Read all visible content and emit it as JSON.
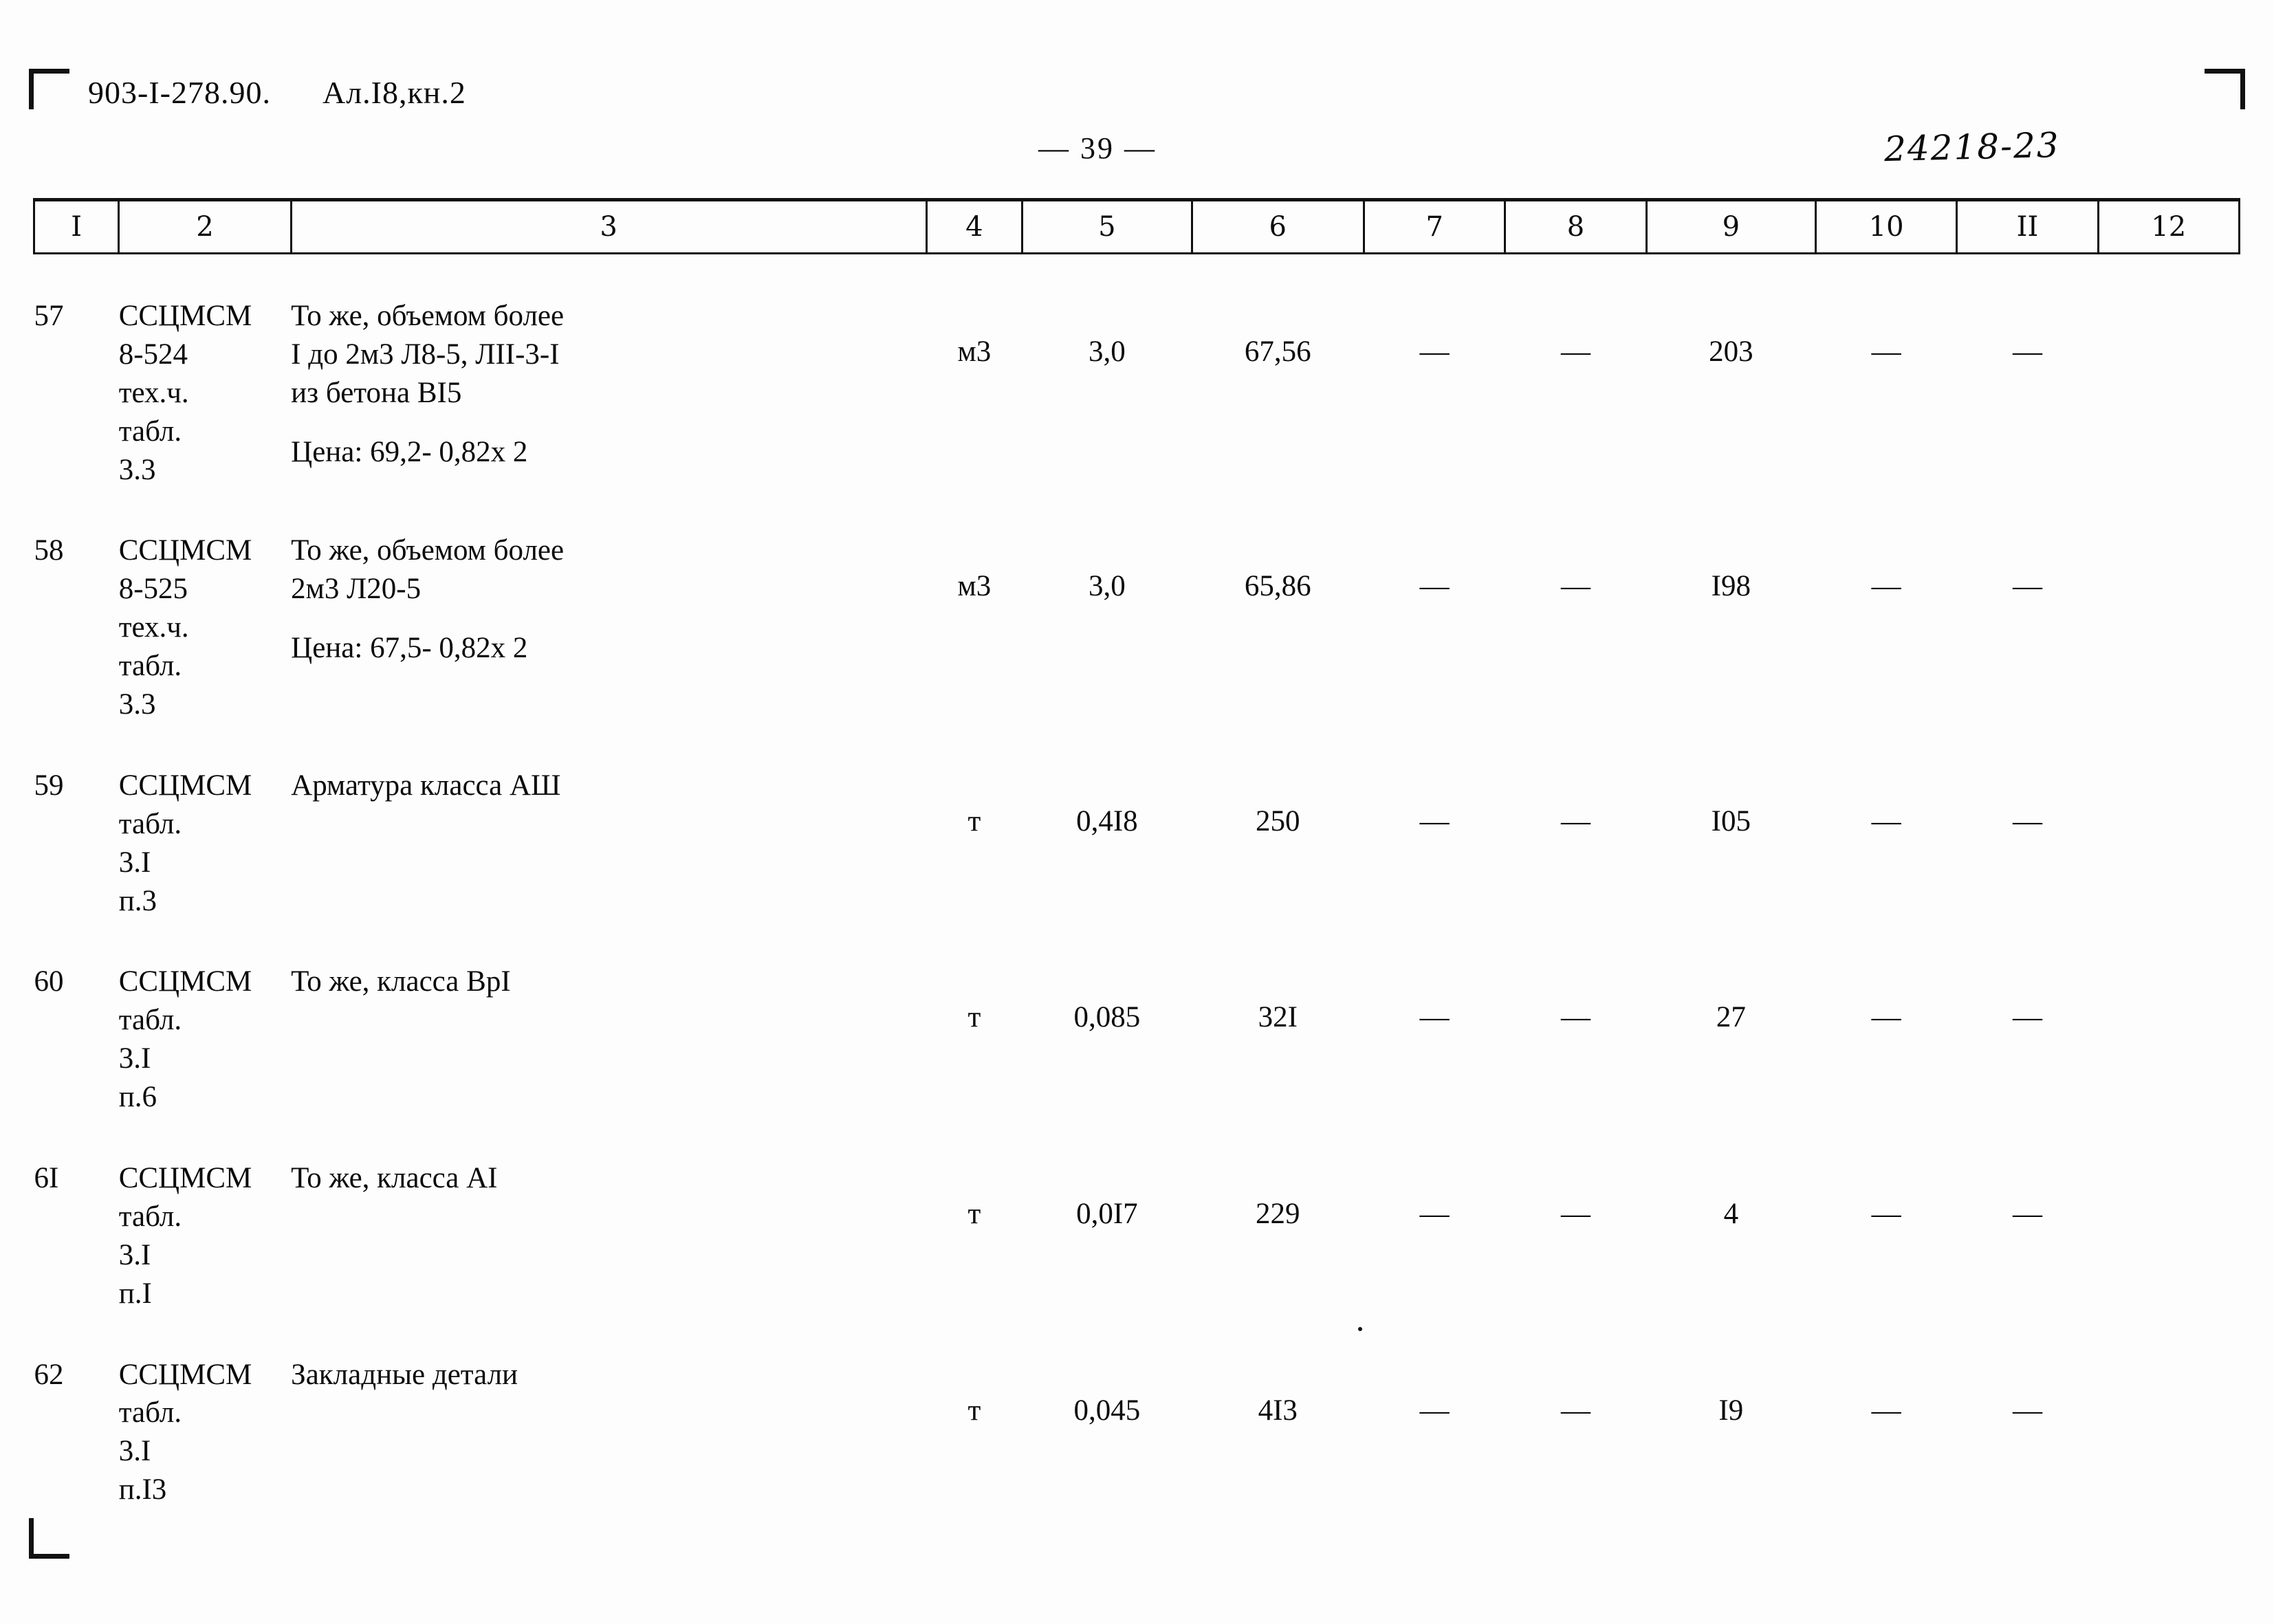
{
  "header": {
    "doc_code": "903-I-278.90.",
    "album": "Ал.I8,кн.2",
    "page_number": "—  39  —",
    "stamp": "24218-23"
  },
  "table": {
    "column_headers": [
      "I",
      "2",
      "3",
      "4",
      "5",
      "6",
      "7",
      "8",
      "9",
      "10",
      "II",
      "12"
    ],
    "rows": [
      {
        "num": "57",
        "code": "ССЦМСМ\n8-524\nтех.ч.\nтабл.\n3.3",
        "desc": "То же, объемом более\nI до 2м3 Л8-5, ЛII-3-I\nиз бетона BI5",
        "price_note": "Цена: 69,2- 0,82х 2",
        "unit": "м3",
        "c5": "3,0",
        "c6": "67,56",
        "c7": "—",
        "c8": "—",
        "c9": "203",
        "c10": "—",
        "c11": "—",
        "c12": ""
      },
      {
        "num": "58",
        "code": "ССЦМСМ\n8-525\nтех.ч.\nтабл.\n3.3",
        "desc": "То же, объемом более\n2м3 Л20-5",
        "price_note": "Цена: 67,5- 0,82х 2",
        "unit": "м3",
        "c5": "3,0",
        "c6": "65,86",
        "c7": "—",
        "c8": "—",
        "c9": "I98",
        "c10": "—",
        "c11": "—",
        "c12": ""
      },
      {
        "num": "59",
        "code": "ССЦМСМ\nтабл.\n3.I\nп.3",
        "desc": "Арматура класса АШ",
        "price_note": "",
        "unit": "т",
        "c5": "0,4I8",
        "c6": "250",
        "c7": "—",
        "c8": "—",
        "c9": "I05",
        "c10": "—",
        "c11": "—",
        "c12": ""
      },
      {
        "num": "60",
        "code": "ССЦМСМ\nтабл.\n3.I\nп.6",
        "desc": "То же, класса ВрI",
        "price_note": "",
        "unit": "т",
        "c5": "0,085",
        "c6": "32I",
        "c7": "—",
        "c8": "—",
        "c9": "27",
        "c10": "—",
        "c11": "—",
        "c12": ""
      },
      {
        "num": "6I",
        "code": "ССЦМСМ\nтабл.\n3.I\nп.I",
        "desc": "То же, класса АI",
        "price_note": "",
        "unit": "т",
        "c5": "0,0I7",
        "c6": "229",
        "c7": "—",
        "c8": "—",
        "c9": "4",
        "c10": "—",
        "c11": "—",
        "c12": ""
      },
      {
        "num": "62",
        "code": "ССЦМСМ\nтабл.\n3.I\nп.I3",
        "desc": "Закладные детали",
        "price_note": "",
        "unit": "т",
        "c5": "0,045",
        "c6": "4I3",
        "c7": "—",
        "c8": "—",
        "c9": "I9",
        "c10": "—",
        "c11": "—",
        "c12": ""
      }
    ]
  }
}
